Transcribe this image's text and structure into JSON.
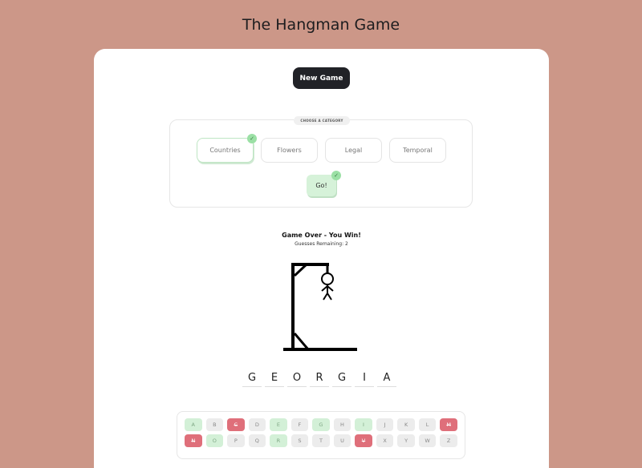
{
  "page": {
    "title": "The Hangman Game"
  },
  "controls": {
    "new_game_label": "New Game"
  },
  "category": {
    "legend": "CHOOSE A CATEGORY",
    "options": [
      {
        "label": "Countries",
        "selected": true
      },
      {
        "label": "Flowers",
        "selected": false
      },
      {
        "label": "Legal",
        "selected": false
      },
      {
        "label": "Temporal",
        "selected": false
      }
    ],
    "go_label": "Go!",
    "check_glyph": "✓"
  },
  "game": {
    "status": "Game Over - You Win!",
    "remaining_label": "Guesses Remaining:",
    "remaining_value": "2",
    "word": [
      "G",
      "E",
      "O",
      "R",
      "G",
      "I",
      "A"
    ]
  },
  "keyboard": {
    "rows": [
      [
        {
          "letter": "A",
          "state": "hit"
        },
        {
          "letter": "B",
          "state": "unused"
        },
        {
          "letter": "C",
          "state": "miss"
        },
        {
          "letter": "D",
          "state": "unused"
        },
        {
          "letter": "E",
          "state": "hit"
        },
        {
          "letter": "F",
          "state": "unused"
        },
        {
          "letter": "G",
          "state": "hit"
        },
        {
          "letter": "H",
          "state": "unused"
        },
        {
          "letter": "I",
          "state": "hit"
        },
        {
          "letter": "J",
          "state": "unused"
        },
        {
          "letter": "K",
          "state": "unused"
        },
        {
          "letter": "L",
          "state": "unused"
        },
        {
          "letter": "M",
          "state": "miss"
        }
      ],
      [
        {
          "letter": "N",
          "state": "miss"
        },
        {
          "letter": "O",
          "state": "hit"
        },
        {
          "letter": "P",
          "state": "unused"
        },
        {
          "letter": "Q",
          "state": "unused"
        },
        {
          "letter": "R",
          "state": "hit"
        },
        {
          "letter": "S",
          "state": "unused"
        },
        {
          "letter": "T",
          "state": "unused"
        },
        {
          "letter": "U",
          "state": "unused"
        },
        {
          "letter": "V",
          "state": "miss"
        },
        {
          "letter": "X",
          "state": "unused"
        },
        {
          "letter": "Y",
          "state": "unused"
        },
        {
          "letter": "W",
          "state": "unused"
        },
        {
          "letter": "Z",
          "state": "unused"
        }
      ]
    ]
  },
  "colors": {
    "background": "#cc9788",
    "hit": "#d3f0d7",
    "miss": "#df6f7a",
    "button_dark": "#212227"
  }
}
